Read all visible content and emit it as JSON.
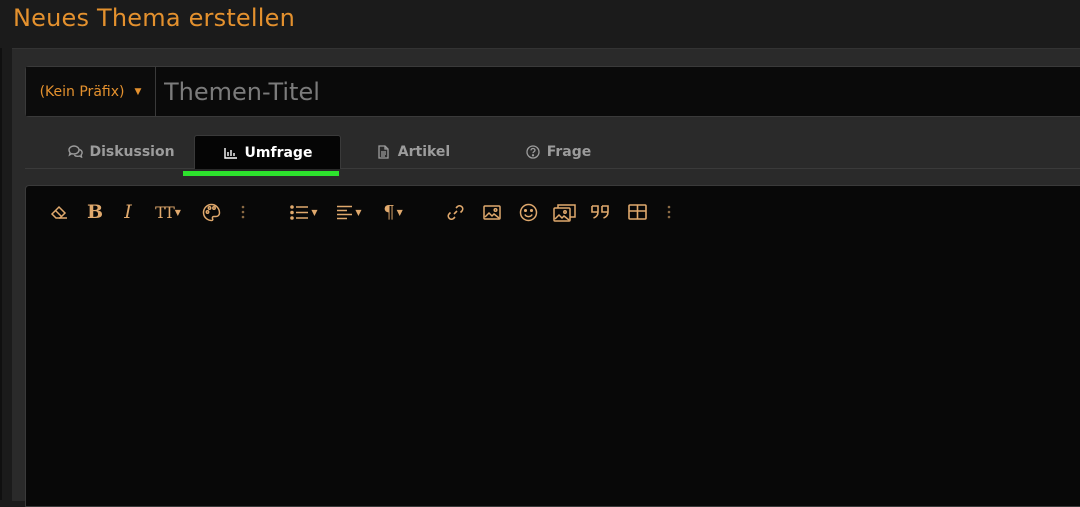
{
  "page": {
    "title": "Neues Thema erstellen"
  },
  "form": {
    "prefix_label": "(Kein Präfix)",
    "title_placeholder": "Themen-Titel",
    "title_value": ""
  },
  "tabs": [
    {
      "label": "Diskussion",
      "icon": "comments-icon",
      "active": false
    },
    {
      "label": "Umfrage",
      "icon": "bar-chart-icon",
      "active": true
    },
    {
      "label": "Artikel",
      "icon": "document-icon",
      "active": false
    },
    {
      "label": "Frage",
      "icon": "question-circle-icon",
      "active": false
    }
  ],
  "toolbar": {
    "buttons": [
      "eraser-icon",
      "bold-icon",
      "italic-icon",
      "text-size-icon",
      "palette-icon",
      "more-vertical-icon",
      "list-icon",
      "align-left-icon",
      "paragraph-icon",
      "link-icon",
      "image-icon",
      "emoji-icon",
      "media-gallery-icon",
      "quote-icon",
      "table-icon",
      "more-vertical-icon"
    ],
    "bold_glyph": "B",
    "italic_glyph": "I",
    "text_size_glyph": "TT",
    "paragraph_glyph": "¶"
  },
  "colors": {
    "accent": "#e4912e",
    "icon": "#e0a96d",
    "active_tab_underline": "#2de32d",
    "background": "#1b1b1b"
  }
}
